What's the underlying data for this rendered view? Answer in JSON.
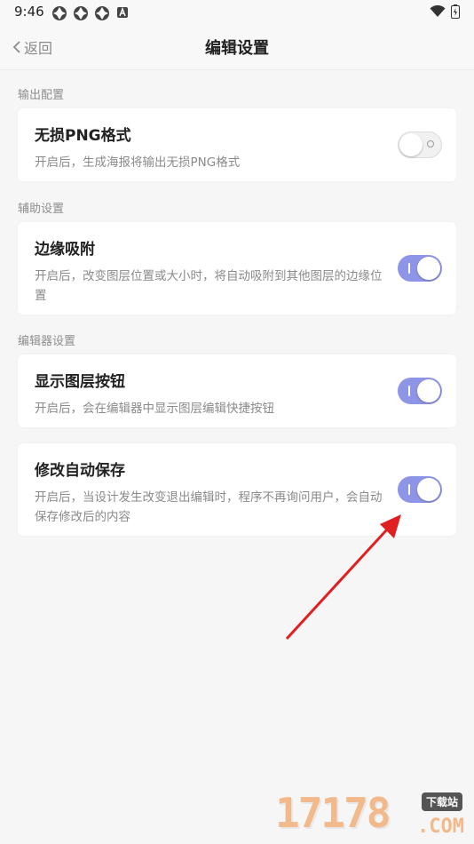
{
  "status_bar": {
    "time": "9:46"
  },
  "nav": {
    "back_label": "返回",
    "title": "编辑设置"
  },
  "sections": [
    {
      "label": "输出配置"
    },
    {
      "label": "辅助设置"
    },
    {
      "label": "编辑器设置"
    }
  ],
  "settings": [
    {
      "title": "无损PNG格式",
      "desc": "开启后，生成海报将输出无损PNG格式",
      "enabled": false
    },
    {
      "title": "边缘吸附",
      "desc": "开启后，改变图层位置或大小时，将自动吸附到其他图层的边缘位置",
      "enabled": true
    },
    {
      "title": "显示图层按钮",
      "desc": "开启后，会在编辑器中显示图层编辑快捷按钮",
      "enabled": true
    },
    {
      "title": "修改自动保存",
      "desc": "开启后，当设计发生改变退出编辑时，程序不再询问用户，会自动保存修改后的内容",
      "enabled": true
    }
  ],
  "colors": {
    "toggle_on": "#8f95e6",
    "annotation_arrow": "#e02020"
  },
  "watermark": {
    "number": "17178",
    "badge": "下载站",
    "domain": ".COM"
  }
}
